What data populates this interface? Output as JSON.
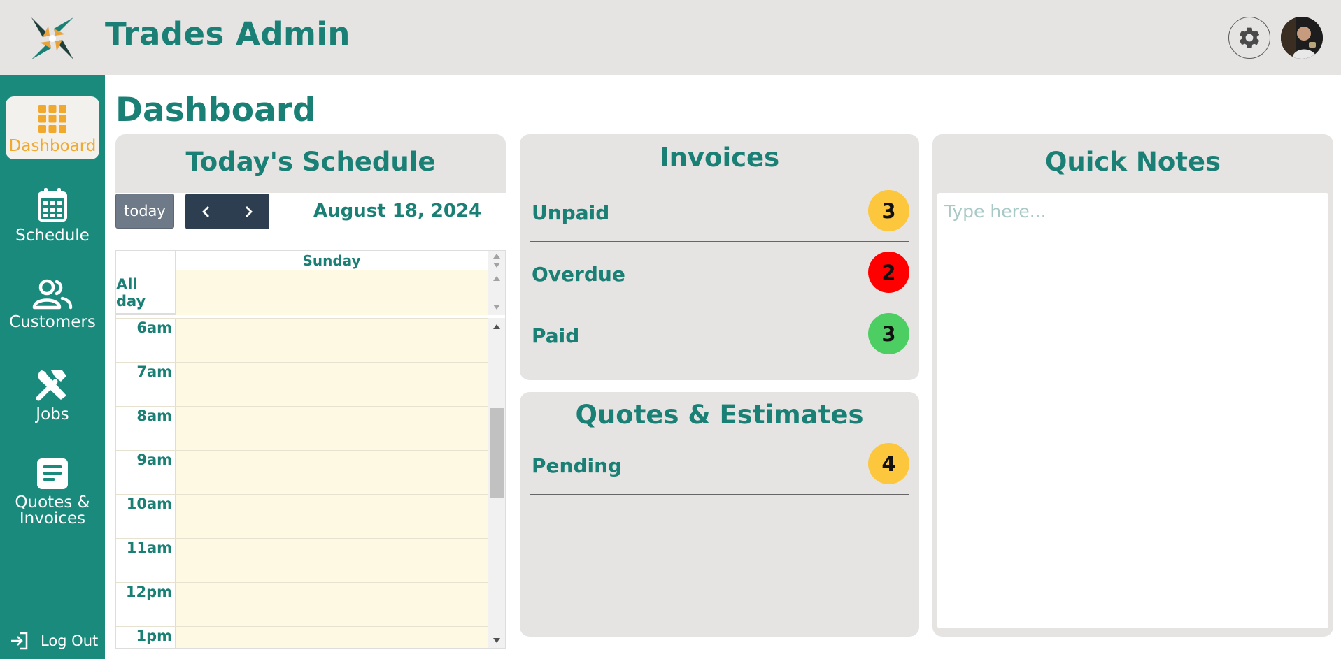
{
  "app": {
    "title": "Trades Admin"
  },
  "header": {
    "settings_icon": "gear-icon",
    "avatar_icon": "user-avatar"
  },
  "sidebar": {
    "items": [
      {
        "label": "Dashboard",
        "icon": "grid-icon",
        "active": true
      },
      {
        "label": "Schedule",
        "icon": "calendar-icon",
        "active": false
      },
      {
        "label": "Customers",
        "icon": "users-icon",
        "active": false
      },
      {
        "label": "Jobs",
        "icon": "tools-icon",
        "active": false
      },
      {
        "label_line1": "Quotes &",
        "label_line2": "Invoices",
        "icon": "document-icon",
        "active": false
      }
    ],
    "logout": {
      "label": "Log Out",
      "icon": "logout-icon"
    }
  },
  "page": {
    "title": "Dashboard"
  },
  "schedule": {
    "title": "Today's Schedule",
    "today_label": "today",
    "date": "August 18, 2024",
    "day_header": "Sunday",
    "allday_label": "All day",
    "times": [
      "6am",
      "7am",
      "8am",
      "9am",
      "10am",
      "11am",
      "12pm",
      "1pm"
    ]
  },
  "invoices": {
    "title": "Invoices",
    "rows": [
      {
        "label": "Unpaid",
        "count": "3",
        "color": "#fcc63d"
      },
      {
        "label": "Overdue",
        "count": "2",
        "color": "#ff0000"
      },
      {
        "label": "Paid",
        "count": "3",
        "color": "#4cce63"
      }
    ]
  },
  "quotes": {
    "title": "Quotes & Estimates",
    "rows": [
      {
        "label": "Pending",
        "count": "4",
        "color": "#fcc63d"
      }
    ]
  },
  "notes": {
    "title": "Quick Notes",
    "placeholder": "Type here..."
  },
  "colors": {
    "brand": "#1a7f74",
    "sidebar": "#1a8a7d",
    "active_accent": "#f0a92c",
    "card_bg": "#e5e4e3",
    "calendar_slot": "#fef9e2",
    "nav_dark": "#2c3e50"
  }
}
